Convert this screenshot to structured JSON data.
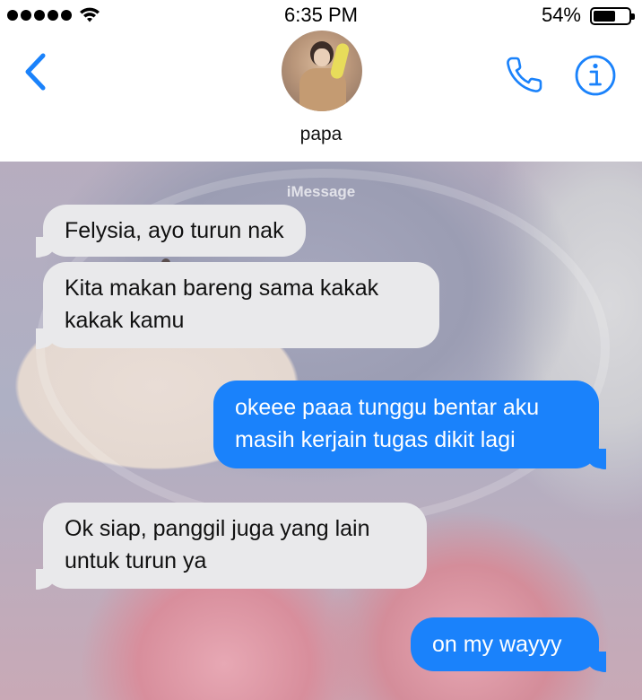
{
  "status_bar": {
    "time": "6:35 PM",
    "battery": "54%",
    "battery_level": 0.54,
    "signal_bars": 5
  },
  "header": {
    "contact_name": "papa",
    "back_icon": "chevron-left-icon",
    "call_icon": "phone-icon",
    "info_icon": "info-icon",
    "accent_color": "#1a82fb"
  },
  "chat": {
    "service_label": "iMessage",
    "messages": [
      {
        "direction": "incoming",
        "text": "Felysia, ayo turun nak"
      },
      {
        "direction": "incoming",
        "lines": [
          "Kita makan bareng sama kakak",
          "kakak kamu"
        ]
      },
      {
        "direction": "outgoing",
        "lines": [
          "okeee paaa tunggu bentar aku",
          "masih kerjain tugas dikit lagi"
        ]
      },
      {
        "direction": "incoming",
        "lines": [
          "Ok siap, panggil juga yang lain",
          "untuk turun ya"
        ]
      },
      {
        "direction": "outgoing",
        "text": "on my wayyy"
      }
    ],
    "incoming_color": "#e9e9eb",
    "outgoing_color": "#1a82fb"
  }
}
